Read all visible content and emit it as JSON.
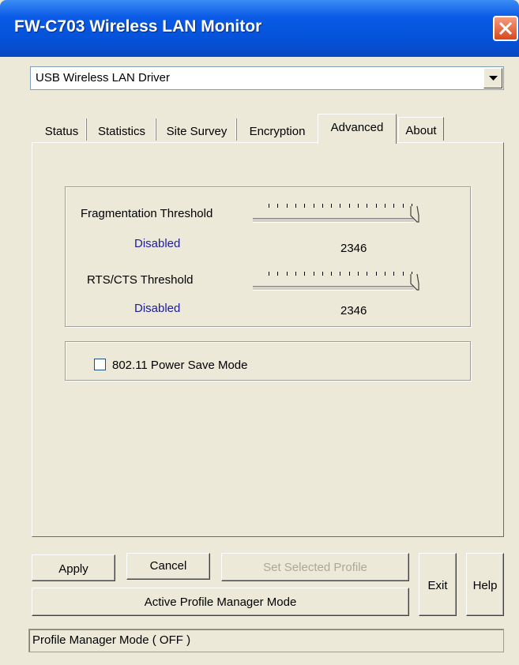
{
  "window": {
    "title": "FW-C703 Wireless LAN Monitor"
  },
  "adapter": {
    "selected": "USB Wireless LAN Driver"
  },
  "tabs": [
    "Status",
    "Statistics",
    "Site Survey",
    "Encryption",
    "Advanced",
    "About"
  ],
  "active_tab": "Advanced",
  "advanced": {
    "fragmentation": {
      "label": "Fragmentation Threshold",
      "state": "Disabled",
      "value": "2346"
    },
    "rts_cts": {
      "label": "RTS/CTS Threshold",
      "state": "Disabled",
      "value": "2346"
    },
    "power_save": {
      "label": "802.11 Power Save Mode",
      "checked": false
    }
  },
  "buttons": {
    "apply": "Apply",
    "cancel": "Cancel",
    "set_profile": "Set Selected Profile",
    "active_profile_manager": "Active Profile Manager Mode",
    "exit": "Exit",
    "help": "Help"
  },
  "status_bar": {
    "text": "Profile Manager Mode ( OFF )"
  },
  "colors": {
    "titlebar": "#0a5ae6",
    "face": "#ece9d8",
    "link_text": "#1c1c9c"
  }
}
